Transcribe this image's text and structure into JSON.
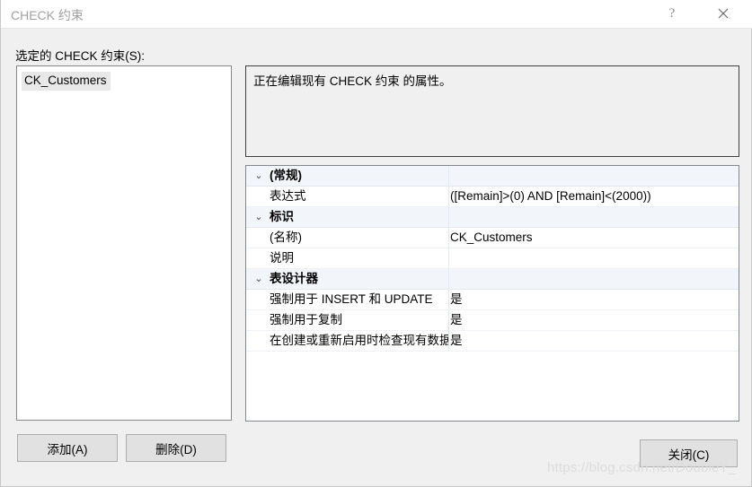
{
  "window": {
    "title": "CHECK 约束",
    "help_icon": "question-mark-icon",
    "close_icon": "close-icon"
  },
  "left_panel": {
    "label": "选定的 CHECK 约束(S):",
    "items": [
      {
        "label": "CK_Customers",
        "selected": true
      }
    ]
  },
  "info_box": {
    "text": "正在编辑现有 CHECK 约束 的属性。"
  },
  "property_grid": {
    "expander_glyph": "⌄",
    "groups": [
      {
        "name": "(常规)",
        "expanded": true,
        "rows": [
          {
            "name": "表达式",
            "value": "([Remain]>(0) AND [Remain]<(2000))"
          }
        ]
      },
      {
        "name": "标识",
        "expanded": true,
        "rows": [
          {
            "name": "(名称)",
            "value": "CK_Customers"
          },
          {
            "name": "说明",
            "value": ""
          }
        ]
      },
      {
        "name": "表设计器",
        "expanded": true,
        "rows": [
          {
            "name": "强制用于 INSERT 和 UPDATE",
            "value": "是"
          },
          {
            "name": "强制用于复制",
            "value": "是"
          },
          {
            "name": "在创建或重新启用时检查现有数据",
            "value": "是"
          }
        ]
      }
    ]
  },
  "buttons": {
    "add": "添加(A)",
    "delete": "删除(D)",
    "close": "关闭(C)"
  },
  "watermark": {
    "text": "https://blog.csdn.net/DoubleY_"
  },
  "colors": {
    "window_background": "#f0f0f0",
    "titlebar_background": "#ffffff",
    "title_text": "#a0a0a0",
    "category_row": "#f2f5fa",
    "selection_highlight": "#e8e8e8",
    "button_face": "#e1e1e1",
    "button_border": "#adadad",
    "watermark": "#dcdcdc"
  }
}
